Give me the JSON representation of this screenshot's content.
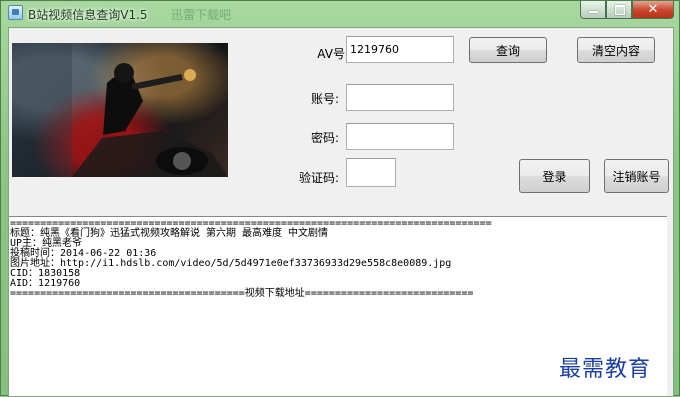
{
  "window": {
    "title": "B站视频信息查询V1.5",
    "title_faded": "迅雷下载吧",
    "close_glyph": "✕",
    "minimize_icon": "minimize-icon",
    "maximize_icon": "maximize-icon"
  },
  "form": {
    "av_label": "AV号:",
    "av_value": "1219760",
    "account_label": "账号:",
    "account_value": "",
    "password_label": "密码:",
    "password_value": "",
    "captcha_label": "验证码:",
    "captcha_value": ""
  },
  "buttons": {
    "query": "查询",
    "clear": "清空内容",
    "login": "登录",
    "logout": "注销账号"
  },
  "output": {
    "lines": [
      "================================================================================",
      "标题：纯黑《看门狗》迅猛式视频攻略解说 第六期 最高难度 中文剧情",
      "UP主：纯黑老爷",
      "投稿时间：2014-06-22 01:36",
      "图片地址：http://i1.hdslb.com/video/5d/5d4971e0ef33736933d29e558c8e0089.jpg",
      "CID：1830158",
      "AID：1219760",
      "=======================================视频下载地址============================"
    ]
  },
  "watermark": "最需教育",
  "colors": {
    "window_frame": "#8cc986",
    "client_bg": "#f0f0f0",
    "watermark": "#1b3f9e",
    "close_button": "#c8442c"
  }
}
